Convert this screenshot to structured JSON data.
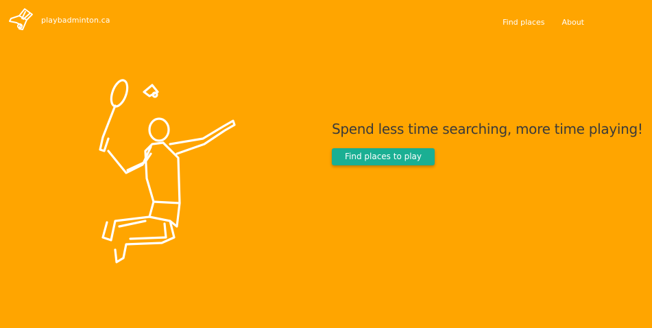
{
  "brand": {
    "name": "playbadminton.ca",
    "logo_icon": "shuttlecock-icon"
  },
  "nav": {
    "items": [
      {
        "label": "Find places"
      },
      {
        "label": "About"
      }
    ]
  },
  "hero": {
    "illustration_icon": "badminton-player-icon",
    "tagline": "Spend less time searching, more time playing!",
    "cta_label": "Find places to play"
  },
  "colors": {
    "background": "#FFA500",
    "accent": "#1AAF93",
    "text_dark": "#3a3a3a",
    "text_light": "#ffffff"
  }
}
